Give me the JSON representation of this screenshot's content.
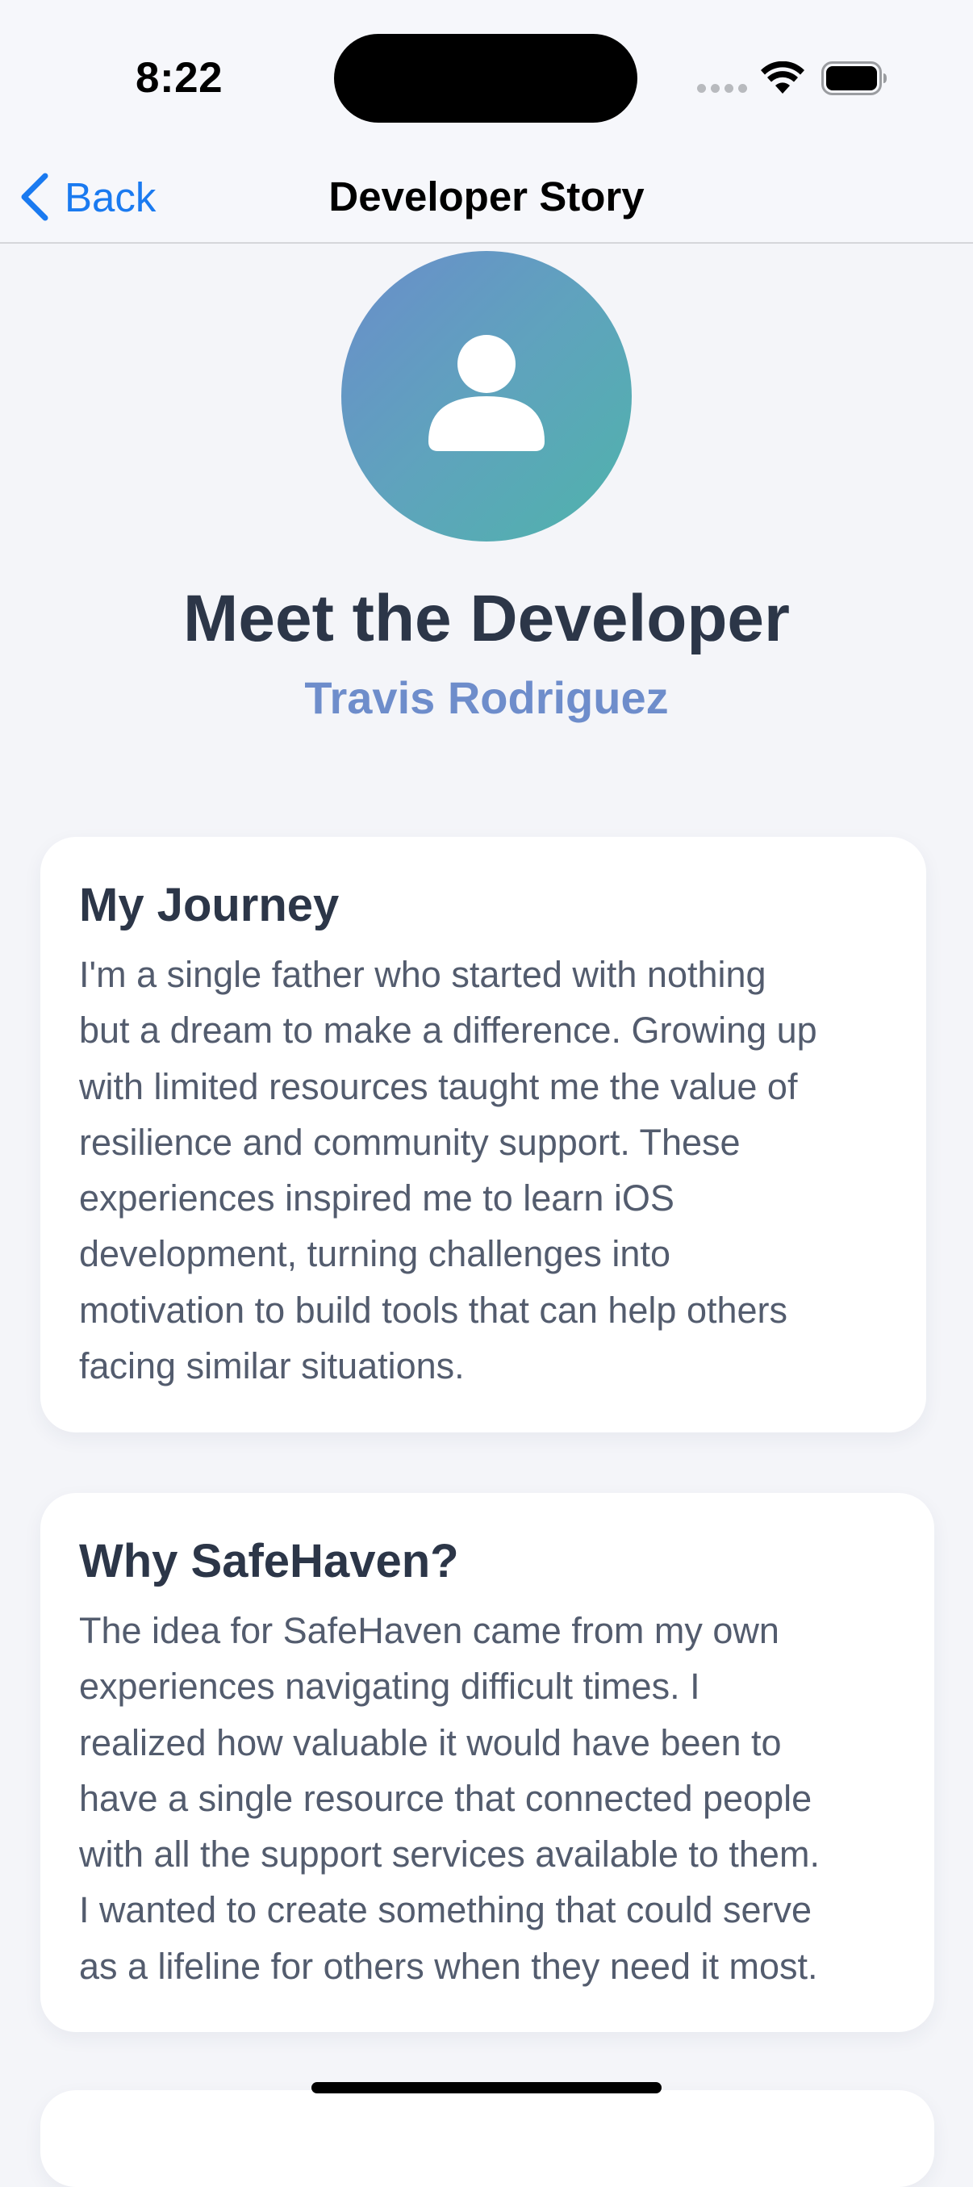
{
  "status_bar": {
    "time": "8:22"
  },
  "nav": {
    "back_label": "Back",
    "title": "Developer Story"
  },
  "hero": {
    "title": "Meet the Developer",
    "name": "Travis Rodriguez"
  },
  "cards": [
    {
      "title": "My Journey",
      "lines": [
        "I'm a single father who started with nothing",
        "but a dream to make a difference. Growing up",
        "with limited resources taught me the value of",
        "resilience and community support. These",
        "experiences inspired me to learn iOS",
        "development, turning challenges into",
        "motivation to build tools that can help others",
        "facing similar situations."
      ]
    },
    {
      "title": "Why SafeHaven?",
      "lines": [
        "The idea for SafeHaven came from my own",
        "experiences navigating difficult times. I",
        "realized how valuable it would have been to",
        "have a single resource that connected people",
        "with all the support services available to them.",
        "I wanted to create something that could serve",
        "as a lifeline for others when they need it most."
      ]
    }
  ],
  "colors": {
    "accent": "#1A7AF0",
    "heading": "#2C3648",
    "subtitle": "#6E8DCB",
    "body": "#535C6E",
    "background": "#F4F5F9",
    "avatar_gradient_start": "#6A8DCB",
    "avatar_gradient_end": "#4FB3AB"
  },
  "icons": {
    "back": "chevron-left-icon",
    "avatar": "person-icon",
    "wifi": "wifi-icon",
    "battery": "battery-icon",
    "signal": "cellular-signal-icon"
  }
}
